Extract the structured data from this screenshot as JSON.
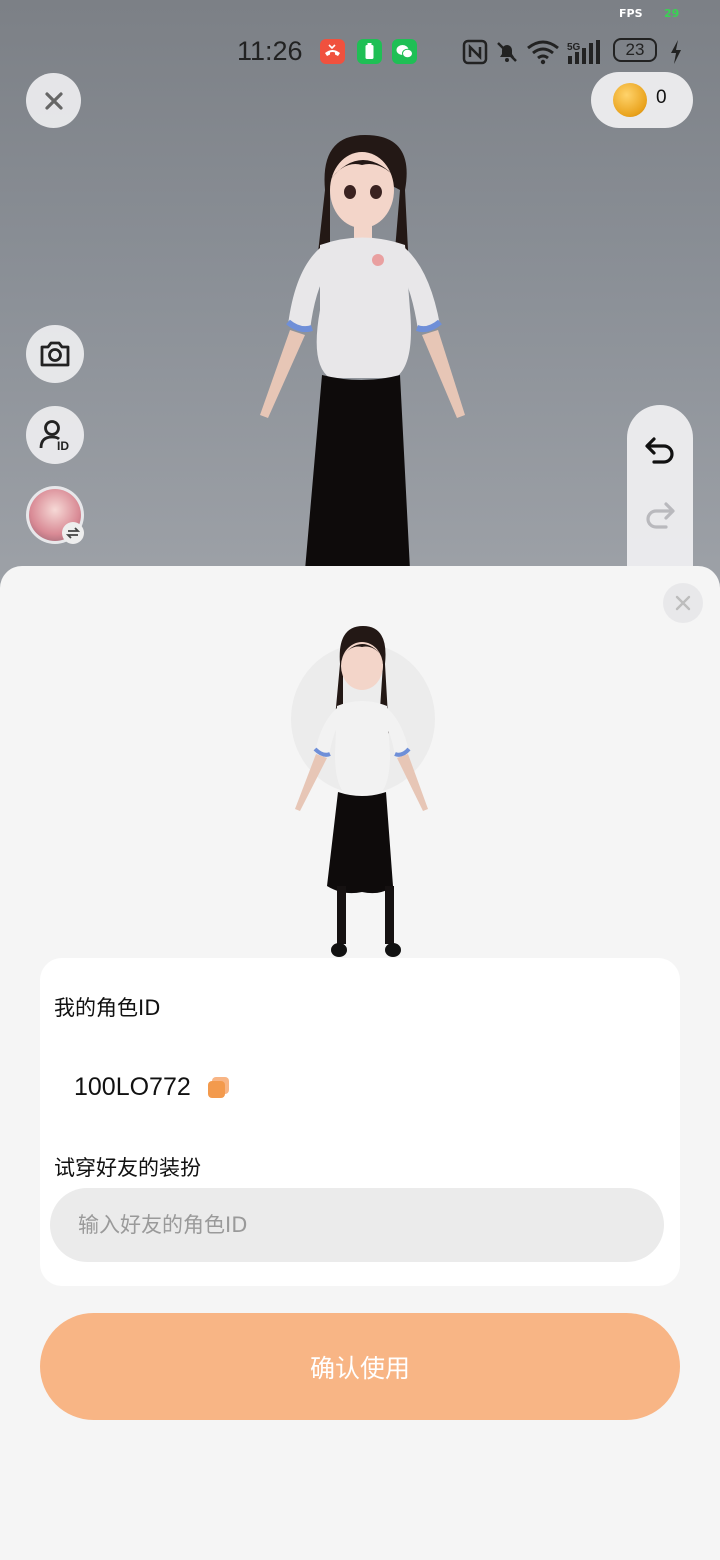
{
  "debug": {
    "fps_label": "FPS",
    "fps_value": "29"
  },
  "status_bar": {
    "time": "11:26",
    "battery": "23",
    "network": "5G",
    "notifications": [
      "missed-call-icon",
      "battery-app-icon",
      "wechat-icon"
    ],
    "system_icons": [
      "nfc-icon",
      "mute-icon",
      "wifi-icon",
      "signal-icon",
      "charging-icon"
    ]
  },
  "top_bar": {
    "close_icon": "close-icon",
    "coins": "0"
  },
  "side_tools": [
    "camera-icon",
    "avatar-id-icon",
    "switch-avatar-icon"
  ],
  "history": [
    "undo-icon",
    "redo-icon"
  ],
  "sheet": {
    "my_id_label": "我的角色ID",
    "my_id_value": "100LO772",
    "tryon_label": "试穿好友的装扮",
    "friend_id_placeholder": "输入好友的角色ID",
    "confirm_label": "确认使用"
  },
  "colors": {
    "accent": "#f8b585",
    "fps_green": "#39d353",
    "copy_orange": "#f39a4d"
  }
}
